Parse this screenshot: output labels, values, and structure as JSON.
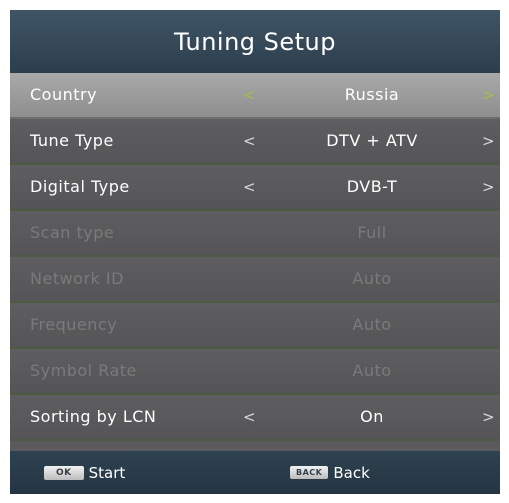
{
  "header": {
    "title": "Tuning Setup"
  },
  "arrows": {
    "left": "<",
    "right": ">"
  },
  "rows": [
    {
      "label": "Country",
      "value": "Russia",
      "arrows": true,
      "selected": true,
      "disabled": false
    },
    {
      "label": "Tune Type",
      "value": "DTV + ATV",
      "arrows": true,
      "selected": false,
      "disabled": false
    },
    {
      "label": "Digital Type",
      "value": "DVB-T",
      "arrows": true,
      "selected": false,
      "disabled": false
    },
    {
      "label": "Scan type",
      "value": "Full",
      "arrows": false,
      "selected": false,
      "disabled": true
    },
    {
      "label": "Network ID",
      "value": "Auto",
      "arrows": false,
      "selected": false,
      "disabled": true
    },
    {
      "label": "Frequency",
      "value": "Auto",
      "arrows": false,
      "selected": false,
      "disabled": true
    },
    {
      "label": "Symbol Rate",
      "value": "Auto",
      "arrows": false,
      "selected": false,
      "disabled": true
    },
    {
      "label": "Sorting by LCN",
      "value": "On",
      "arrows": true,
      "selected": false,
      "disabled": false
    }
  ],
  "footer": {
    "ok_key": "OK",
    "ok_label": "Start",
    "back_key": "BACK",
    "back_label": "Back"
  },
  "colors": {
    "header_bg": "#33495a",
    "row_bg": "#5a5a5c",
    "selected_row_bg": "#9c9c9c",
    "selected_arrow": "#9bc14a",
    "disabled_text": "#7a7a7a"
  }
}
